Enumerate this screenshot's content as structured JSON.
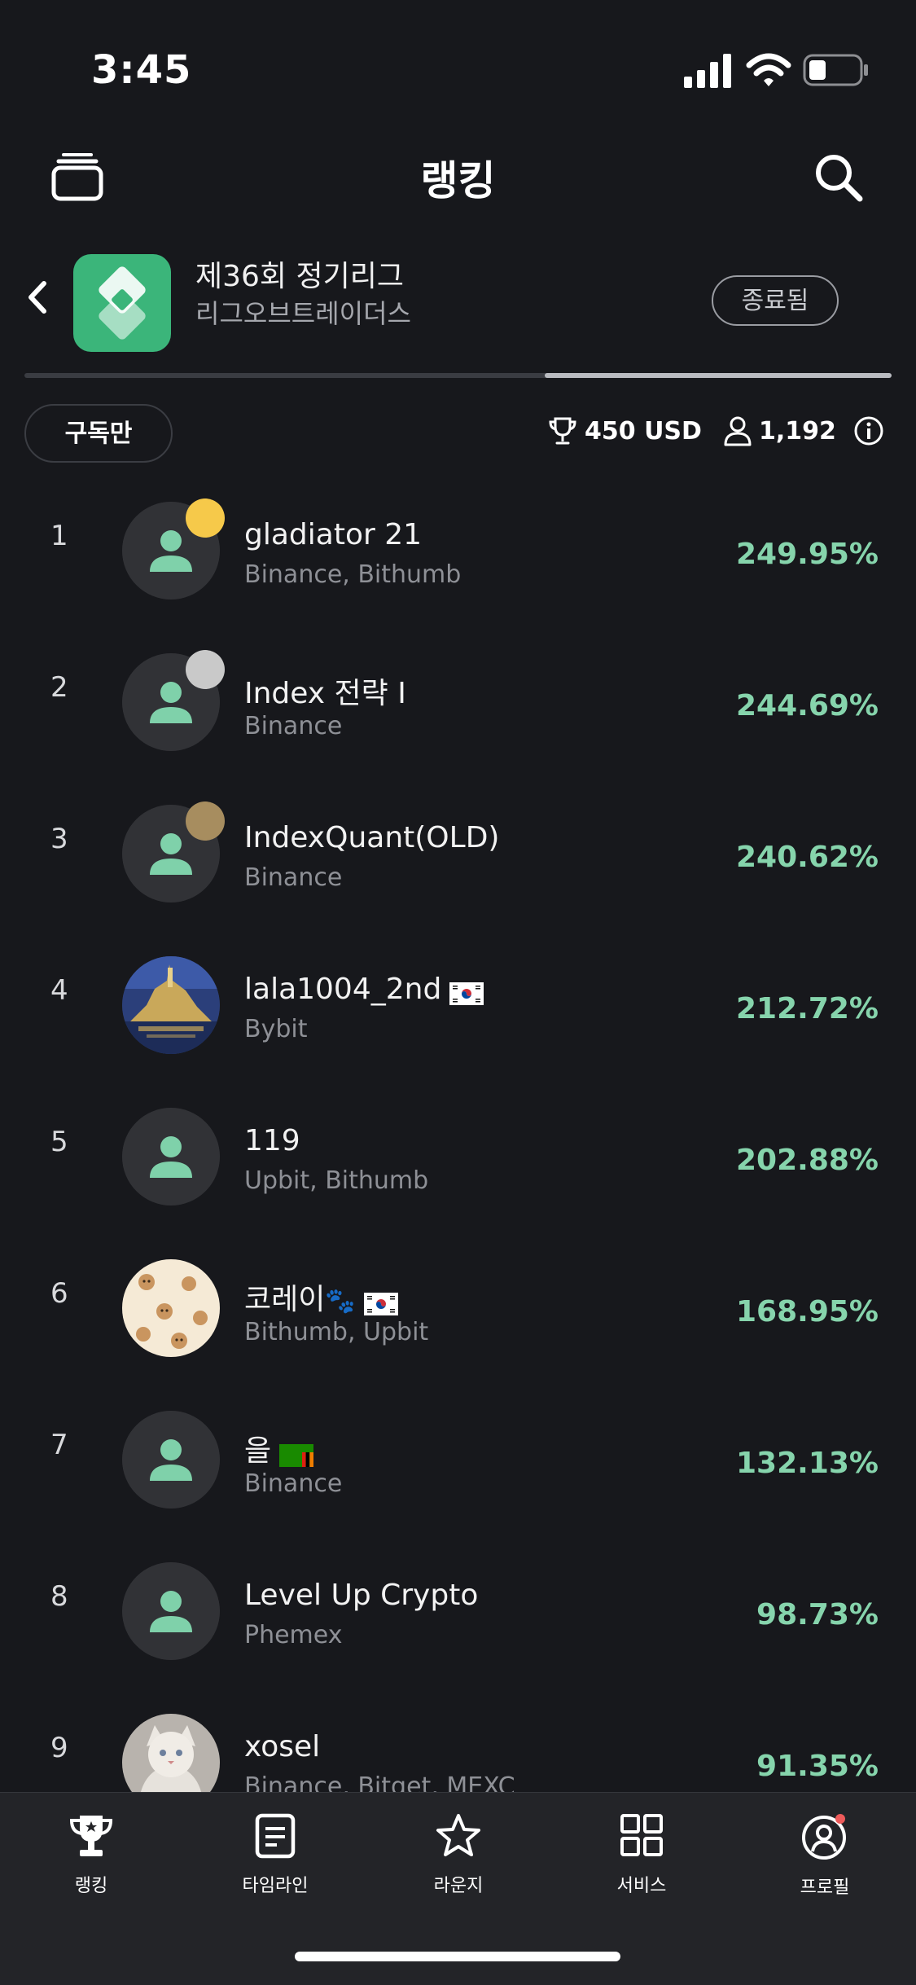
{
  "status": {
    "time": "3:45"
  },
  "header": {
    "title": "랭킹"
  },
  "league": {
    "name": "제36회 정기리그",
    "organizer": "리그오브트레이더스",
    "status_label": "종료됨",
    "progress": 0.6
  },
  "filters": {
    "subscribed_label": "구독만",
    "prize": "450 USD",
    "participants": "1,192"
  },
  "rankings": [
    {
      "rank": "1",
      "name": "gladiator 21",
      "exchanges": "Binance, Bithumb",
      "return": "249.95%",
      "medal": "gold",
      "avatar": "default-avatar"
    },
    {
      "rank": "2",
      "name": "Index 전략 I",
      "exchanges": "Binance",
      "return": "244.69%",
      "medal": "silver",
      "avatar": "default-avatar"
    },
    {
      "rank": "3",
      "name": "IndexQuant(OLD)",
      "exchanges": "Binance",
      "return": "240.62%",
      "medal": "bronze",
      "avatar": "default-avatar"
    },
    {
      "rank": "4",
      "name": "lala1004_2nd",
      "exchanges": "Bybit",
      "return": "212.72%",
      "avatar": "castle-photo",
      "flag": "south-korea-flag"
    },
    {
      "rank": "5",
      "name": "119",
      "exchanges": "Upbit, Bithumb",
      "return": "202.88%",
      "avatar": "default-avatar"
    },
    {
      "rank": "6",
      "name": "코레이",
      "exchanges": "Bithumb, Upbit",
      "return": "168.95%",
      "avatar": "puppy-pattern",
      "flag": "south-korea-flag",
      "emoji": "🐾"
    },
    {
      "rank": "7",
      "name": "을",
      "exchanges": "Binance",
      "return": "132.13%",
      "avatar": "default-avatar",
      "flag": "zambia-flag"
    },
    {
      "rank": "8",
      "name": "Level Up Crypto",
      "exchanges": "Phemex",
      "return": "98.73%",
      "avatar": "default-avatar"
    },
    {
      "rank": "9",
      "name": "xosel",
      "exchanges": "Binance, Bitget, MEXC",
      "return": "91.35%",
      "avatar": "cat-photo"
    }
  ],
  "tabs": [
    {
      "label": "랭킹",
      "icon": "trophy-icon"
    },
    {
      "label": "타임라인",
      "icon": "document-icon"
    },
    {
      "label": "라운지",
      "icon": "star-icon"
    },
    {
      "label": "서비스",
      "icon": "grid-icon"
    },
    {
      "label": "프로필",
      "icon": "profile-icon"
    }
  ],
  "colors": {
    "background": "#17181c",
    "positive": "#86d4ac",
    "gold": "#f6c94a",
    "silver": "#c9c9c9",
    "bronze": "#a78d5f",
    "accent_green": "#3bb57a"
  }
}
